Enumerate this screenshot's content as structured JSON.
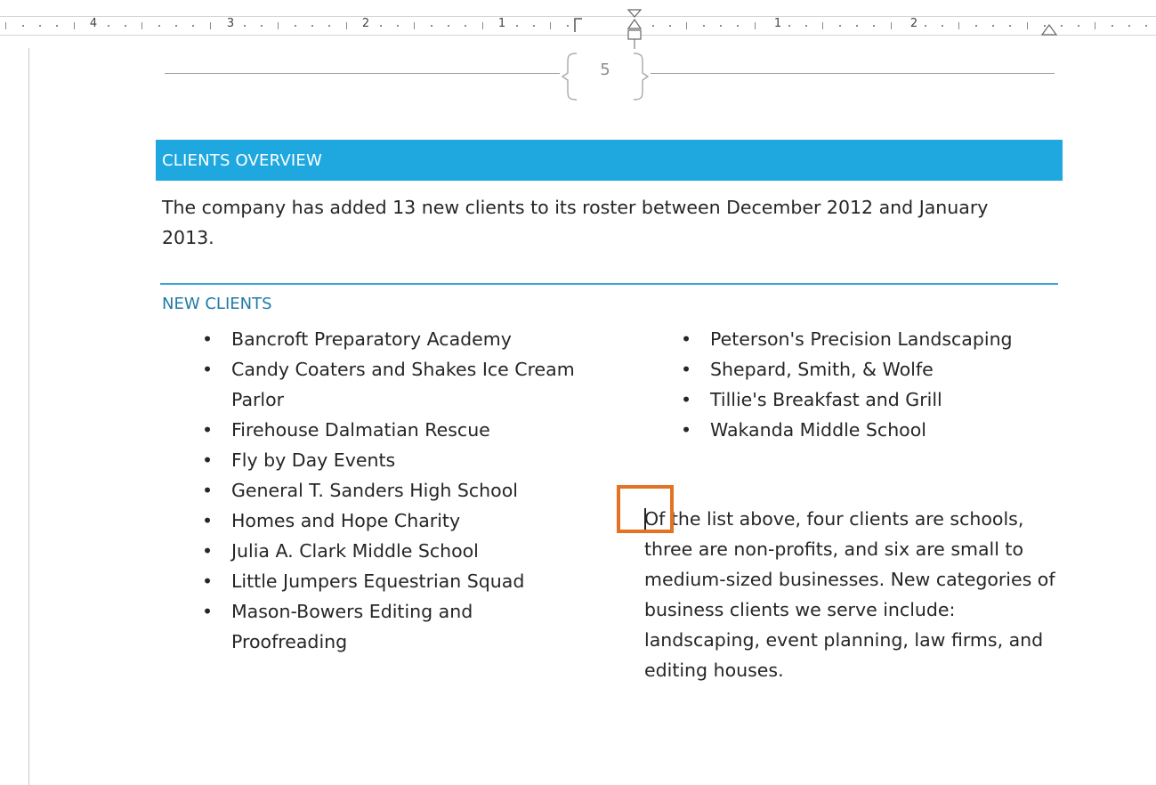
{
  "ruler": {
    "numbers": [
      "4",
      "3",
      "2",
      "1",
      "1",
      "2"
    ]
  },
  "header": {
    "page_number": "5"
  },
  "document": {
    "overview_title": "CLIENTS OVERVIEW",
    "intro_text": "The company has added 13 new clients to its roster between December 2012 and January 2013.",
    "new_clients_heading": "NEW CLIENTS",
    "left_list": [
      "Bancroft Preparatory Academy",
      "Candy Coaters and Shakes Ice Cream Parlor",
      "Firehouse Dalmatian Rescue",
      "Fly by Day Events",
      "General T. Sanders High School",
      "Homes and Hope Charity",
      "Julia A. Clark Middle School",
      "Little Jumpers Equestrian Squad",
      "Mason-Bowers Editing and Proofreading"
    ],
    "right_list": [
      "Peterson's Precision Landscaping",
      "Shepard, Smith, & Wolfe",
      "Tillie's Breakfast and Grill",
      "Wakanda Middle School"
    ],
    "summary_text": "Of the list above, four clients are schools, three are non-profits, and six are small to medium-sized businesses. New categories of business clients we serve include: landscaping, event planning, law firms, and editing houses."
  },
  "colors": {
    "accent_bar": "#1fa8e0",
    "heading_blue": "#1f7aa8",
    "highlight_orange": "#e37322"
  }
}
